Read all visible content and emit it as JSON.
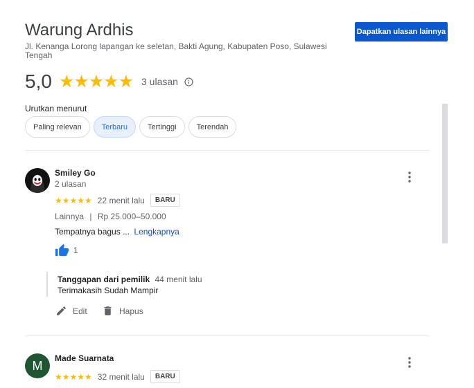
{
  "place": {
    "name": "Warung Ardhis",
    "address": "Jl. Kenanga Lorong lapangan ke seletan, Bakti Agung, Kabupaten Poso, Sulawesi Tengah",
    "cta_label": "Dapatkan ulasan lainnya"
  },
  "rating": {
    "value": "5,0",
    "stars": "★★★★★",
    "review_count": "3 ulasan"
  },
  "sort": {
    "label": "Urutkan menurut",
    "options": [
      "Paling relevan",
      "Terbaru",
      "Tertinggi",
      "Terendah"
    ],
    "selected": "Terbaru"
  },
  "reviews": [
    {
      "author": "Smiley Go",
      "author_meta": "2 ulasan",
      "stars": "★★★★★",
      "time": "22 menit lalu",
      "badge": "BARU",
      "category": "Lainnya",
      "separator": "|",
      "price": "Rp 25.000–50.000",
      "text": "Tempatnya bagus ...",
      "more_link": "Lengkapnya",
      "likes": "1",
      "owner_reply": {
        "label": "Tanggapan dari pemilik",
        "time": "44 menit lalu",
        "text": "Terimakasih Sudah Mampir"
      },
      "actions": {
        "edit": "Edit",
        "delete": "Hapus"
      }
    },
    {
      "author": "Made Suarnata",
      "avatar_letter": "M",
      "avatar_color": "#1e5631",
      "stars": "★★★★★",
      "time": "32 menit lalu",
      "badge": "BARU"
    }
  ],
  "colors": {
    "accent": "#0b57d0",
    "star": "#fbbc04",
    "like": "#1a73e8"
  }
}
